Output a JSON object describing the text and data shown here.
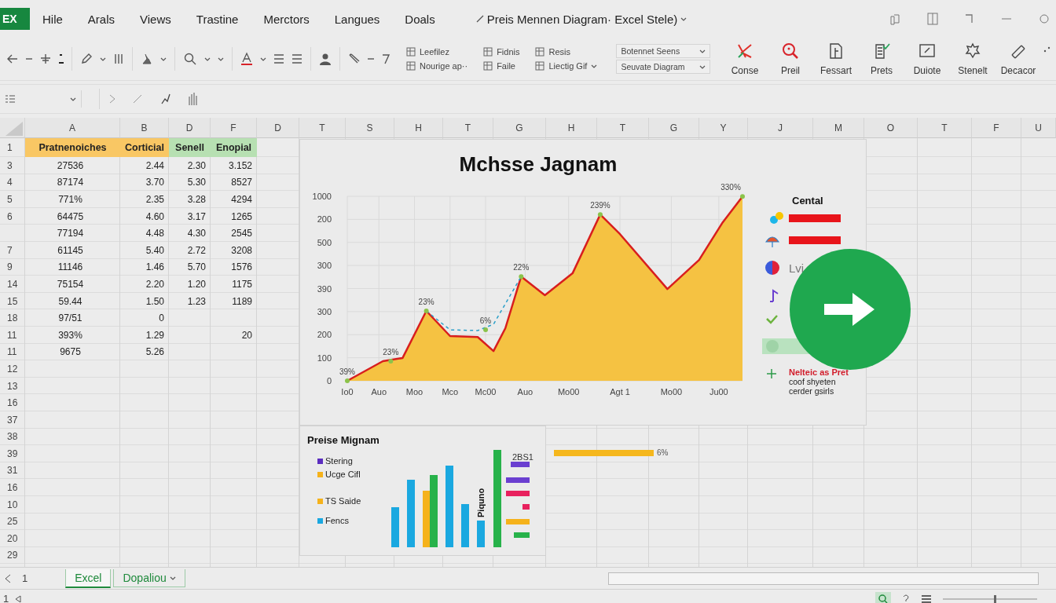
{
  "app": {
    "logo": "EX",
    "menu": [
      "Hile",
      "Arals",
      "Views",
      "Trastine",
      "Merctors",
      "Langues",
      "Doals"
    ],
    "title": "Preis Mennen Diagram· Excel Stele)"
  },
  "ribbon": {
    "small_buttons": [
      [
        "Leefilez",
        "Nourige ap··"
      ],
      [
        "Fidnis",
        "Faile"
      ],
      [
        "Resis",
        "Liectig Gif"
      ]
    ],
    "dropdowns": [
      "Botennet Seens",
      "Seuvate Diagram"
    ],
    "big_buttons": [
      "Conse",
      "Preil",
      "Fessart",
      "Prets",
      "Duiote",
      "Stenelt",
      "Decacor"
    ]
  },
  "sheet": {
    "columns": [
      "A",
      "B",
      "D",
      "F",
      "D",
      "T",
      "S",
      "H",
      "T",
      "G",
      "H",
      "T",
      "G",
      "Y",
      "J",
      "M",
      "O",
      "T",
      "F",
      "U"
    ],
    "header_row": {
      "label": "1",
      "cells": [
        {
          "text": "Pratnenoiches",
          "color": "#f9c764"
        },
        {
          "text": "Corticial",
          "color": "#f9c764"
        },
        {
          "text": "Senell",
          "color": "#b7e0b2"
        },
        {
          "text": "Enopial",
          "color": "#b7e0b2"
        }
      ]
    },
    "rows": [
      {
        "label": "3",
        "cells": [
          "27536",
          "2.44",
          "2.30",
          "3.152"
        ]
      },
      {
        "label": "4",
        "cells": [
          "87174",
          "3.70",
          "5.30",
          "8527"
        ]
      },
      {
        "label": "5",
        "cells": [
          "771%",
          "2.35",
          "3.28",
          "4294"
        ]
      },
      {
        "label": "6",
        "cells": [
          "64475",
          "4.60",
          "3.17",
          "1265"
        ]
      },
      {
        "cells": [
          "77194",
          "4.48",
          "4.30",
          "2545"
        ]
      },
      {
        "label": "7",
        "cells": [
          "61145",
          "5.40",
          "2.72",
          "3208"
        ]
      },
      {
        "label": "9",
        "cells": [
          "11146",
          "1.46",
          "5.70",
          "1576"
        ]
      },
      {
        "label": "14",
        "cells": [
          "75154",
          "2.20",
          "1.20",
          "1175"
        ]
      },
      {
        "label": "15",
        "cells": [
          "59.44",
          "1.50",
          "1.23",
          "1189"
        ]
      },
      {
        "label": "18",
        "cells": [
          "97/51",
          "0",
          null,
          null
        ]
      },
      {
        "label": "11",
        "cells": [
          "393%",
          "1.29",
          null,
          "20"
        ]
      },
      {
        "label": "11",
        "cells": [
          "9675",
          "5.26",
          null,
          null
        ]
      },
      {
        "label": "12",
        "cells": []
      },
      {
        "label": "13",
        "cells": []
      },
      {
        "label": "16",
        "cells": []
      },
      {
        "label": "37",
        "cells": []
      },
      {
        "label": "38",
        "cells": []
      },
      {
        "label": "39",
        "cells": []
      },
      {
        "label": "31",
        "cells": []
      },
      {
        "label": "16",
        "cells": []
      },
      {
        "label": "10",
        "cells": []
      },
      {
        "label": "25",
        "cells": []
      },
      {
        "label": "20",
        "cells": []
      },
      {
        "label": "29",
        "cells": []
      }
    ]
  },
  "main_chart": {
    "title": "Mchsse Jagnam",
    "y_labels": [
      "1000",
      "200",
      "500",
      "300",
      "390",
      "300",
      "200",
      "100",
      "0"
    ],
    "x_labels": [
      "Io0",
      "Auo",
      "Moo",
      "Mco",
      "Mc00",
      "Auo",
      "Mo00",
      "Agt 1",
      "Mo00",
      "Ju00"
    ],
    "point_labels": [
      "39%",
      "23%",
      "23%",
      "6%",
      "22%",
      "239%",
      "330%"
    ],
    "legend": {
      "title": "Cental",
      "entries": [
        {
          "kind": "bar"
        },
        {
          "kind": "bar"
        },
        {
          "kind": "label",
          "label": "Lvi"
        },
        {
          "kind": "icon"
        },
        {
          "kind": "icon"
        },
        {
          "kind": "pill"
        }
      ],
      "note": [
        "Nelteic as Pret",
        "coof shyeten",
        "cerder gsirls"
      ]
    }
  },
  "small_chart": {
    "title": "Preise Mignam",
    "legend": [
      {
        "label": "Stering",
        "color": "#5b2dbf"
      },
      {
        "label": "Ucge Cifl",
        "color": "#f5b21b"
      },
      {
        "label": "TS Saide",
        "color": "#f5b21b"
      },
      {
        "label": "Fencs",
        "color": "#1aa8e0"
      }
    ],
    "axis_label": "Piquno",
    "value_label": "2BS1"
  },
  "data_bar": {
    "label": "6%"
  },
  "sheet_tabs": {
    "page": "1",
    "tabs": [
      {
        "label": "Excel",
        "selected": true
      },
      {
        "label": "Dopaliou",
        "selected": false
      }
    ]
  },
  "status_bar": {
    "page": "1",
    "zoom": {
      "level": 0.55
    }
  }
}
